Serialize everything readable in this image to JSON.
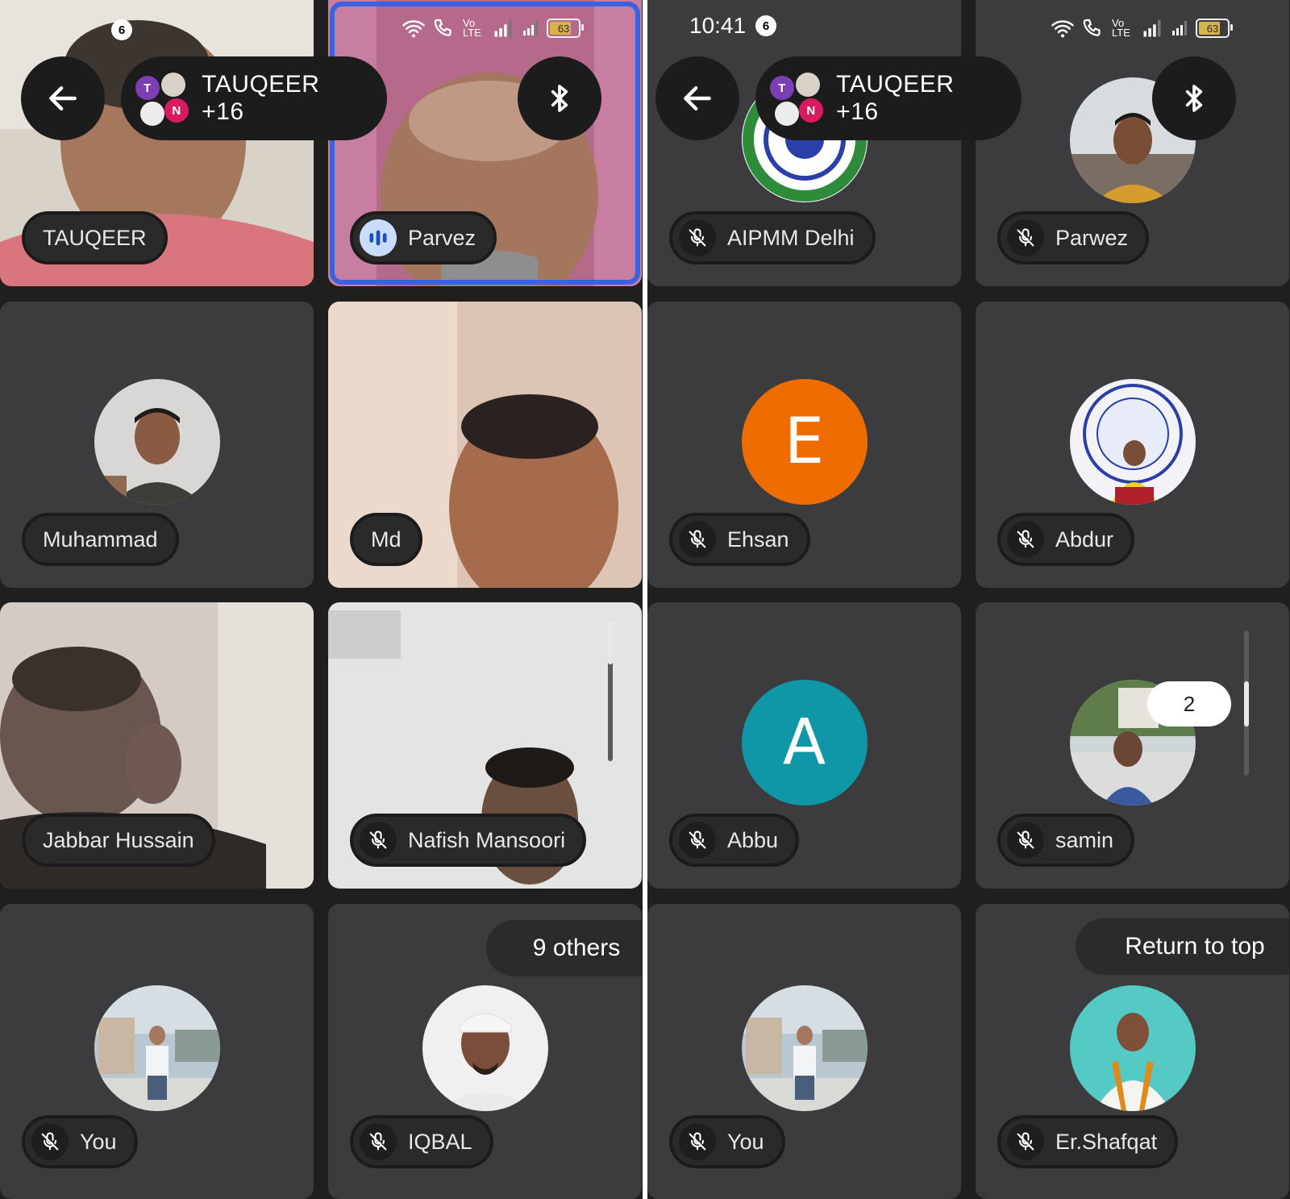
{
  "left": {
    "status": {
      "notif_count": "6",
      "battery": "63"
    },
    "header": {
      "back_icon": "arrow-left-icon",
      "group_title": "TAUQEER +16",
      "group_initials": [
        "T",
        "N"
      ],
      "audio_icon": "bluetooth-icon"
    },
    "tiles": [
      {
        "name": "TAUQEER",
        "label_icon": "none"
      },
      {
        "name": "Parvez",
        "label_icon": "speaking-icon",
        "active": true
      },
      {
        "name": "Muhammad",
        "label_icon": "none"
      },
      {
        "name": "Md",
        "label_icon": "none"
      },
      {
        "name": "Jabbar Hussain",
        "label_icon": "none"
      },
      {
        "name": "Nafish Mansoori",
        "label_icon": "mic-off-icon"
      },
      {
        "name": "You",
        "label_icon": "mic-off-icon"
      },
      {
        "name": "IQBAL",
        "label_icon": "mic-off-icon"
      }
    ],
    "others_pill": "9 others"
  },
  "right": {
    "status": {
      "time": "10:41",
      "notif_count": "6",
      "battery": "63"
    },
    "header": {
      "back_icon": "arrow-left-icon",
      "group_title": "TAUQEER +16",
      "group_initials": [
        "T",
        "N"
      ],
      "audio_icon": "bluetooth-icon"
    },
    "tiles": [
      {
        "name": "AIPMM Delhi",
        "label_icon": "mic-off-icon"
      },
      {
        "name": "Parwez",
        "label_icon": "mic-off-icon"
      },
      {
        "name": "Ehsan",
        "label_icon": "mic-off-icon",
        "avatar_letter": "E",
        "avatar_color": "#ef6c00"
      },
      {
        "name": "Abdur",
        "label_icon": "mic-off-icon"
      },
      {
        "name": "Abbu",
        "label_icon": "mic-off-icon",
        "avatar_letter": "A",
        "avatar_color": "#0f97a8"
      },
      {
        "name": "samin",
        "label_icon": "mic-off-icon"
      },
      {
        "name": "You",
        "label_icon": "mic-off-icon"
      },
      {
        "name": "Er.Shafqat",
        "label_icon": "mic-off-icon"
      }
    ],
    "scroll_count": "2",
    "return_pill": "Return to top"
  },
  "colors": {
    "accent": "#3a62e0",
    "tile_bg": "#3c3c3e",
    "background": "#1f1f1f"
  }
}
